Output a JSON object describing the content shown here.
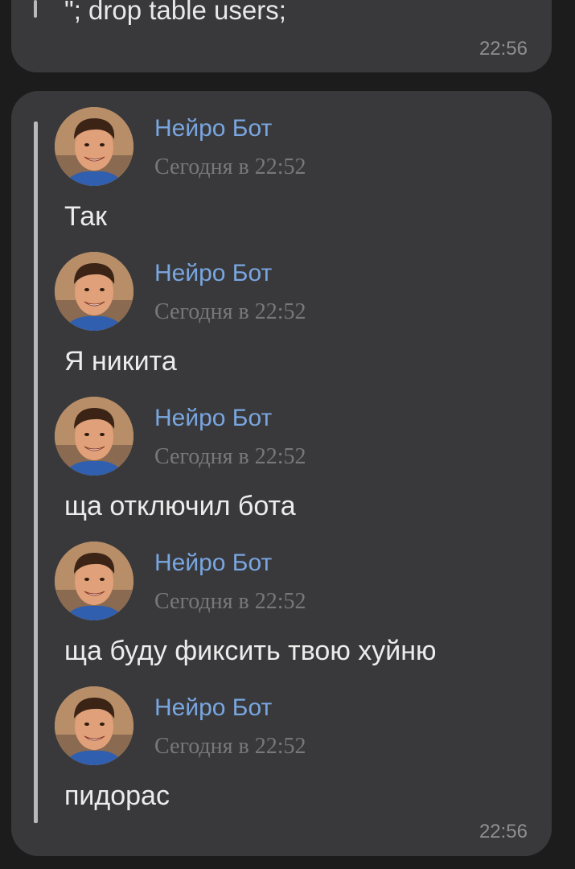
{
  "top_message": {
    "text": "\"; drop table users;",
    "time": "22:56"
  },
  "forwarded_message": {
    "time": "22:56",
    "items": [
      {
        "sender": "Нейро Бот",
        "date": "Сегодня в 22:52",
        "text": "Так"
      },
      {
        "sender": "Нейро Бот",
        "date": "Сегодня в 22:52",
        "text": "Я никита"
      },
      {
        "sender": "Нейро Бот",
        "date": "Сегодня в 22:52",
        "text": "ща отключил бота"
      },
      {
        "sender": "Нейро Бот",
        "date": "Сегодня в 22:52",
        "text": "ща буду фиксить твою хуйню"
      },
      {
        "sender": "Нейро Бот",
        "date": "Сегодня в 22:52",
        "text": "пидорас"
      }
    ]
  },
  "colors": {
    "background": "#1c1c1d",
    "bubble": "#39393b",
    "sender_name": "#79a6e0",
    "secondary_text": "#78787b",
    "message_text": "#ececec"
  },
  "icons": {
    "avatar": "sender-avatar-photo"
  }
}
